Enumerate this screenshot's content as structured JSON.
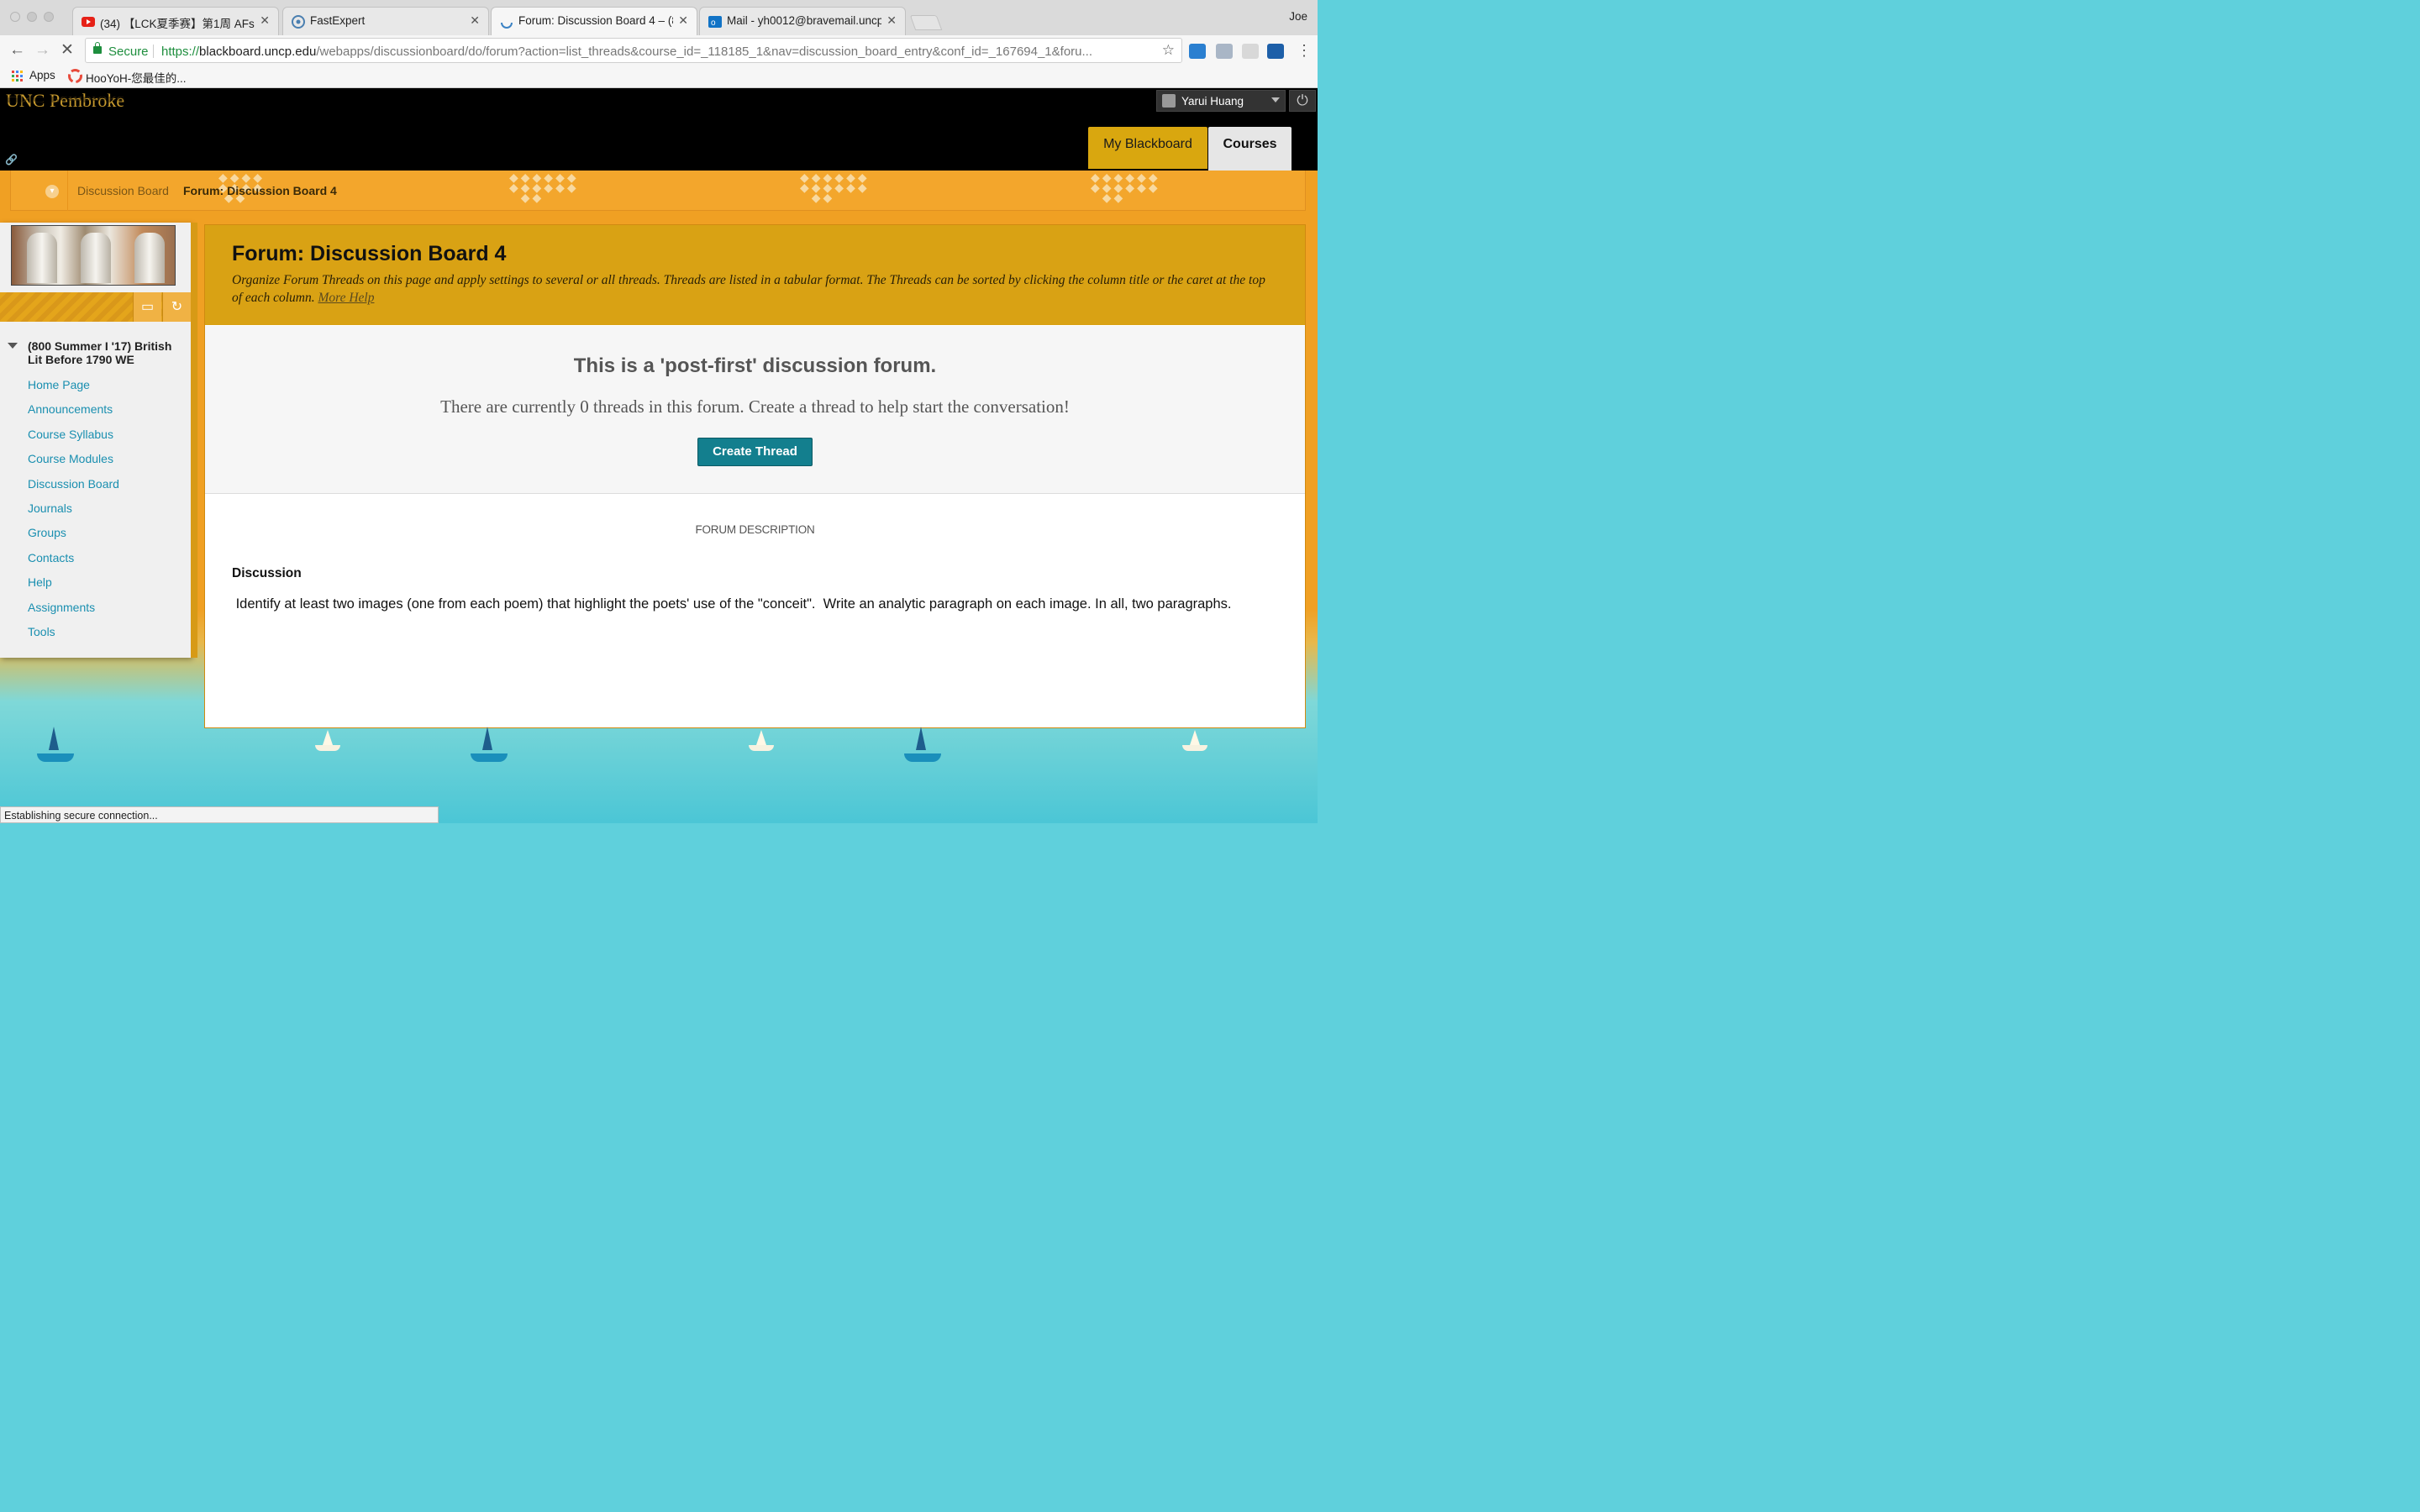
{
  "browser": {
    "tabs": [
      {
        "title": "(34) 【LCK夏季赛】第1周 AFs",
        "icon": "youtube-icon"
      },
      {
        "title": "FastExpert",
        "icon": "fastexpert-icon"
      },
      {
        "title": "Forum: Discussion Board 4 – (8",
        "icon": "loading-spinner-icon"
      },
      {
        "title": "Mail - yh0012@bravemail.uncp",
        "icon": "outlook-icon"
      }
    ],
    "profile_name": "Joe",
    "omnibox": {
      "secure_label": "Secure",
      "scheme": "https://",
      "host": "blackboard.uncp.edu",
      "path": "/webapps/discussionboard/do/forum?action=list_threads&course_id=_118185_1&nav=discussion_board_entry&conf_id=_167694_1&foru..."
    },
    "extensions": [
      "lite-icon",
      "puzzle-icon",
      "bookmark-icon",
      "clapper-icon"
    ],
    "bookmarks": [
      {
        "label": "Apps",
        "icon": "apps-grid-icon"
      },
      {
        "label": "HooYoH-您最佳的...",
        "icon": "hooyoh-icon"
      }
    ],
    "status_text": "Establishing secure connection..."
  },
  "header": {
    "logo": "UNC Pembroke",
    "user_name": "Yarui Huang",
    "tabs": {
      "my_blackboard": "My Blackboard",
      "courses": "Courses"
    }
  },
  "breadcrumb": {
    "items": [
      "Discussion Board",
      "Forum: Discussion Board 4"
    ]
  },
  "course_menu": {
    "course_title": "(800 Summer I '17) British Lit Before 1790 WE",
    "items": [
      "Home Page",
      "Announcements",
      "Course Syllabus",
      "Course Modules",
      "Discussion Board",
      "Journals",
      "Groups",
      "Contacts",
      "Help",
      "Assignments",
      "Tools"
    ]
  },
  "forum": {
    "title": "Forum: Discussion Board 4",
    "instructions": "Organize Forum Threads on this page and apply settings to several or all threads. Threads are listed in a tabular format. The Threads can be sorted by clicking the column title or the caret at the top of each column.",
    "more_help": "More Help",
    "post_first_title": "This is a 'post-first' discussion forum.",
    "post_first_subtitle": "There are currently 0 threads in this forum. Create a thread to help start the conversation!",
    "create_button": "Create Thread",
    "description_label": "FORUM DESCRIPTION",
    "description_heading": "Discussion",
    "description_body": " Identify at least two images (one from each poem) that highlight the poets' use of the \"conceit\".  Write an analytic paragraph on each image. In all, two paragraphs."
  },
  "colors": {
    "brand_gold": "#d9a214",
    "orange_bg": "#f0a023",
    "link_teal": "#1a8fb0",
    "button_teal": "#137f8e"
  }
}
